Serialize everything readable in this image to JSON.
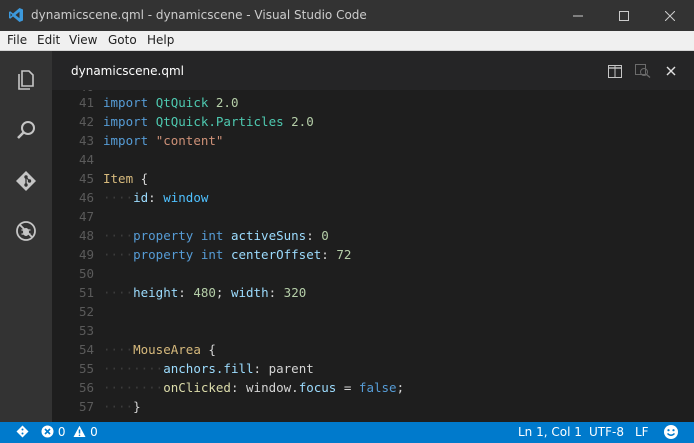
{
  "window": {
    "title": "dynamicscene.qml - dynamicscene - Visual Studio Code"
  },
  "menu": [
    "File",
    "Edit",
    "View",
    "Goto",
    "Help"
  ],
  "activity_icons": [
    "files-icon",
    "search-icon",
    "git-icon",
    "debug-icon"
  ],
  "tab": {
    "label": "dynamicscene.qml"
  },
  "code_lines": [
    {
      "n": "41",
      "dots": "",
      "parts": [
        [
          "kw",
          "import "
        ],
        [
          "ty",
          "QtQuick "
        ],
        [
          "num",
          "2.0"
        ]
      ]
    },
    {
      "n": "42",
      "dots": "",
      "parts": [
        [
          "kw",
          "import "
        ],
        [
          "ty",
          "QtQuick.Particles "
        ],
        [
          "num",
          "2.0"
        ]
      ]
    },
    {
      "n": "43",
      "dots": "",
      "parts": [
        [
          "kw",
          "import "
        ],
        [
          "str",
          "\"content\""
        ]
      ]
    },
    {
      "n": "44",
      "dots": "",
      "parts": []
    },
    {
      "n": "45",
      "dots": "",
      "parts": [
        [
          "item",
          "Item "
        ],
        [
          "ws",
          "{"
        ]
      ]
    },
    {
      "n": "46",
      "dots": "····",
      "parts": [
        [
          "prop",
          "id"
        ],
        [
          "ws",
          ": "
        ],
        [
          "id",
          "window"
        ]
      ]
    },
    {
      "n": "47",
      "dots": "",
      "parts": []
    },
    {
      "n": "48",
      "dots": "····",
      "parts": [
        [
          "kw",
          "property "
        ],
        [
          "kw",
          "int "
        ],
        [
          "prop",
          "activeSuns"
        ],
        [
          "ws",
          ": "
        ],
        [
          "num",
          "0"
        ]
      ]
    },
    {
      "n": "49",
      "dots": "····",
      "parts": [
        [
          "kw",
          "property "
        ],
        [
          "kw",
          "int "
        ],
        [
          "prop",
          "centerOffset"
        ],
        [
          "ws",
          ": "
        ],
        [
          "num",
          "72"
        ]
      ]
    },
    {
      "n": "50",
      "dots": "",
      "parts": []
    },
    {
      "n": "51",
      "dots": "····",
      "parts": [
        [
          "prop",
          "height"
        ],
        [
          "ws",
          ": "
        ],
        [
          "num",
          "480"
        ],
        [
          "ws",
          "; "
        ],
        [
          "prop",
          "width"
        ],
        [
          "ws",
          ": "
        ],
        [
          "num",
          "320"
        ]
      ]
    },
    {
      "n": "52",
      "dots": "",
      "parts": []
    },
    {
      "n": "53",
      "dots": "",
      "parts": []
    },
    {
      "n": "54",
      "dots": "····",
      "parts": [
        [
          "item",
          "MouseArea "
        ],
        [
          "ws",
          "{"
        ]
      ]
    },
    {
      "n": "55",
      "dots": "········",
      "parts": [
        [
          "prop",
          "anchors.fill"
        ],
        [
          "ws",
          ": "
        ],
        [
          "ws",
          "parent"
        ]
      ]
    },
    {
      "n": "56",
      "dots": "········",
      "parts": [
        [
          "fn",
          "onClicked"
        ],
        [
          "ws",
          ": "
        ],
        [
          "ws",
          "window."
        ],
        [
          "prop",
          "focus"
        ],
        [
          "ws",
          " = "
        ],
        [
          "kw",
          "false"
        ],
        [
          "ws",
          ";"
        ]
      ]
    },
    {
      "n": "57",
      "dots": "····",
      "parts": [
        [
          "ws",
          "}"
        ]
      ]
    }
  ],
  "status": {
    "errors": "0",
    "warnings": "0",
    "position": "Ln 1, Col 1",
    "encoding": "UTF-8",
    "eol": "LF"
  },
  "colors": {
    "accent": "#007acc",
    "titlebar": "#333333",
    "editor_bg": "#1e1e1e"
  }
}
